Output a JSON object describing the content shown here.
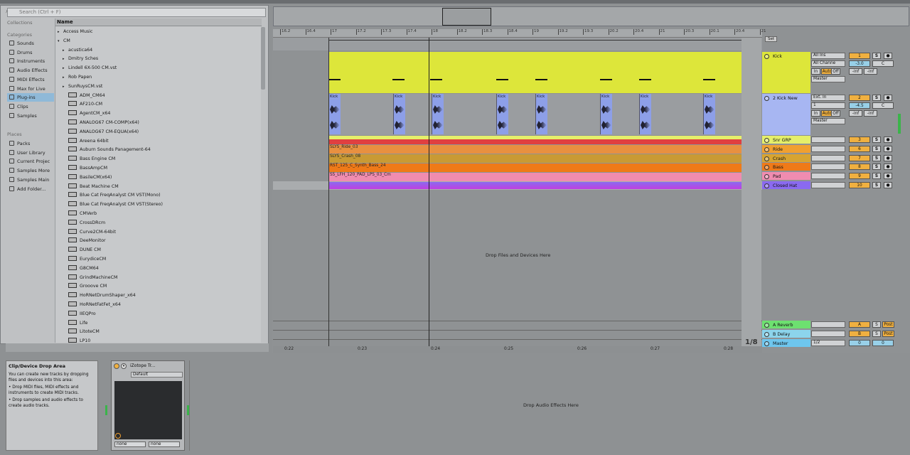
{
  "search": {
    "placeholder": "Search (Ctrl + F)"
  },
  "sidebar": {
    "collections_header": "Collections",
    "categories_header": "Categories",
    "categories": [
      "Sounds",
      "Drums",
      "Instruments",
      "Audio Effects",
      "MIDI Effects",
      "Max for Live",
      "Plug-ins",
      "Clips",
      "Samples"
    ],
    "selected": "Plug-ins",
    "places_header": "Places",
    "places": [
      "Packs",
      "User Library",
      "Current Projec",
      "Samples More",
      "Samples Main",
      "Add Folder..."
    ]
  },
  "list": {
    "header": "Name",
    "items": [
      {
        "label": "Access Music",
        "type": "folder",
        "depth": 0
      },
      {
        "label": "CM",
        "type": "folder-open",
        "depth": 0
      },
      {
        "label": "acustica64",
        "type": "folder",
        "depth": 1
      },
      {
        "label": "Dmitry Sches",
        "type": "folder",
        "depth": 1
      },
      {
        "label": "Lindell 6X-500 CM.vst",
        "type": "folder",
        "depth": 1
      },
      {
        "label": "Rob Papen",
        "type": "folder",
        "depth": 1
      },
      {
        "label": "SunRuysCM.vst",
        "type": "folder",
        "depth": 1
      },
      {
        "label": "ADM_CM64",
        "type": "plugin",
        "depth": 1
      },
      {
        "label": "AF210-CM",
        "type": "plugin",
        "depth": 1
      },
      {
        "label": "AgentCM_x64",
        "type": "plugin",
        "depth": 1
      },
      {
        "label": "ANALOG67 CM-COMP(x64)",
        "type": "plugin",
        "depth": 1
      },
      {
        "label": "ANALOG67 CM-EQUA(x64)",
        "type": "plugin",
        "depth": 1
      },
      {
        "label": "Areena 64bit",
        "type": "plugin",
        "depth": 1
      },
      {
        "label": "Auburn Sounds Panagement-64",
        "type": "plugin",
        "depth": 1
      },
      {
        "label": "Bass Engine CM",
        "type": "plugin",
        "depth": 1
      },
      {
        "label": "BassAmpCM",
        "type": "plugin",
        "depth": 1
      },
      {
        "label": "BasileCM(x64)",
        "type": "plugin",
        "depth": 1
      },
      {
        "label": "Beat Machine CM",
        "type": "plugin",
        "depth": 1
      },
      {
        "label": "Blue Cat FreqAnalyst CM VST(Mono)",
        "type": "plugin",
        "depth": 1
      },
      {
        "label": "Blue Cat FreqAnalyst CM VST(Stereo)",
        "type": "plugin",
        "depth": 1
      },
      {
        "label": "CMVerb",
        "type": "plugin",
        "depth": 1
      },
      {
        "label": "CrossDRcm",
        "type": "plugin",
        "depth": 1
      },
      {
        "label": "Curve2CM-64bit",
        "type": "plugin",
        "depth": 1
      },
      {
        "label": "DeeMonitor",
        "type": "plugin",
        "depth": 1
      },
      {
        "label": "DUNE CM",
        "type": "plugin",
        "depth": 1
      },
      {
        "label": "EurydiceCM",
        "type": "plugin",
        "depth": 1
      },
      {
        "label": "G8CM64",
        "type": "plugin",
        "depth": 1
      },
      {
        "label": "GrindMachineCM",
        "type": "plugin",
        "depth": 1
      },
      {
        "label": "Grooove CM",
        "type": "plugin",
        "depth": 1
      },
      {
        "label": "HoRNetDrumShaper_x64",
        "type": "plugin",
        "depth": 1
      },
      {
        "label": "HoRNetFatFet_x64",
        "type": "plugin",
        "depth": 1
      },
      {
        "label": "IIEQPro",
        "type": "plugin",
        "depth": 1
      },
      {
        "label": "Life",
        "type": "plugin",
        "depth": 1
      },
      {
        "label": "LitoteCM",
        "type": "plugin",
        "depth": 1
      },
      {
        "label": "LP10",
        "type": "plugin",
        "depth": 1
      }
    ]
  },
  "ruler": {
    "ticks": [
      "16.2",
      "16.4",
      "17",
      "17.2",
      "17.3",
      "17.4",
      "18",
      "18.2",
      "18.3",
      "18.4",
      "19",
      "19.2",
      "19.3",
      "20.2",
      "20.4",
      "21",
      "20.3",
      "20.1",
      "20.4",
      "21"
    ]
  },
  "timeline": {
    "times": [
      "0:22",
      "0:23",
      "0:24",
      "0:25",
      "0:26",
      "0:27",
      "0:28"
    ],
    "quantize": "1/8"
  },
  "set_label": "Set",
  "tracks": [
    {
      "name": "Kick",
      "color": "#dde63a",
      "in": "All Ins",
      "ch": "All Channe",
      "mon": [
        "In",
        "Auto",
        "Off"
      ],
      "out": "Master",
      "num": "1",
      "vol": "-3.0",
      "pan": "C",
      "l": "-inf",
      "r": "-inf"
    },
    {
      "name": "2 Kick New",
      "color": "#a7b6f2",
      "in": "Ext. In",
      "ch": "1",
      "mon": [
        "In",
        "Auto",
        "Off"
      ],
      "out": "Master",
      "num": "2",
      "vol": "-4.5",
      "pan": "C",
      "l": "-inf",
      "r": "-inf"
    },
    {
      "name": "Snr GRP",
      "color": "#e5ef6a",
      "num": "3"
    },
    {
      "name": "Ride",
      "color": "#f0a030",
      "num": "6"
    },
    {
      "name": "Crash",
      "color": "#d7a431",
      "num": "7"
    },
    {
      "name": "Bass",
      "color": "#ef7a18",
      "num": "8"
    },
    {
      "name": "Pad",
      "color": "#f08cb0",
      "num": "9"
    },
    {
      "name": "Closed Hat",
      "color": "#8a6af0",
      "num": "10"
    }
  ],
  "clips": {
    "ride": "SLYS_Ride_03",
    "crash": "SLYS_Crash_08",
    "bass": "RST_125_C_Synth_Bass_24",
    "pad": "S5_LFH_120_PAD_LPS_03_Cm",
    "kick_audio": "Kick"
  },
  "returns": [
    {
      "name": "A Reverb",
      "color": "#6de070",
      "num": "A",
      "send": "Post"
    },
    {
      "name": "B Delay",
      "color": "#8cd4ec",
      "num": "B",
      "send": "Post"
    }
  ],
  "master": {
    "name": "Master",
    "color": "#6ec6ee",
    "cue": "1/2",
    "l": "0",
    "r": "0"
  },
  "drop_files": "Drop Files and Devices Here",
  "info": {
    "title": "Clip/Device Drop Area",
    "lines": [
      "You can create new tracks by dropping files and devices into this area:",
      "• Drop MIDI files, MIDI effects and instruments to create MIDI tracks.",
      "• Drop samples and audio effects to create audio tracks."
    ]
  },
  "device": {
    "title": "iZotope Tr...",
    "preset": "Default",
    "dd1": "none",
    "dd2": "none"
  },
  "drop_fx": "Drop Audio Effects Here"
}
